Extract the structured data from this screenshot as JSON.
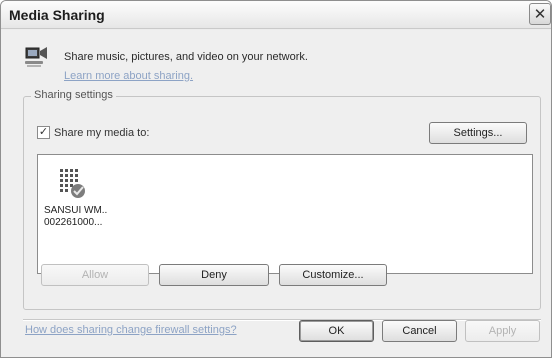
{
  "window": {
    "title": "Media Sharing",
    "close_glyph": "✕"
  },
  "header": {
    "icon": "media-player-icon",
    "description": "Share music, pictures, and video on your network.",
    "learn_more_link": "Learn more about sharing."
  },
  "sharing_settings": {
    "group_label": "Sharing settings",
    "share_checkbox": {
      "label": "Share my media to:",
      "checked": true,
      "check_glyph": "✓"
    },
    "settings_button": "Settings..."
  },
  "devices": [
    {
      "icon": "media-device-allowed-icon",
      "name": "SANSUI WM..",
      "id": "002261000..."
    }
  ],
  "device_actions": {
    "allow": "Allow",
    "deny": "Deny",
    "customize": "Customize..."
  },
  "footer": {
    "firewall_link": "How does sharing change firewall settings?",
    "ok": "OK",
    "cancel": "Cancel",
    "apply": "Apply"
  }
}
